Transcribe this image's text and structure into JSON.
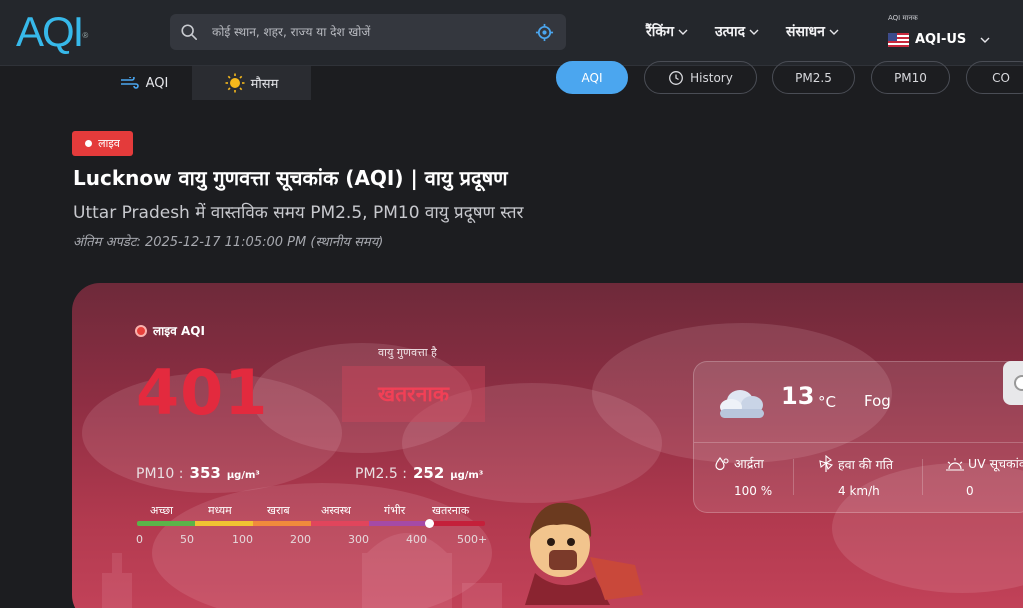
{
  "header": {
    "logo": "AQI",
    "logo_mark": "®",
    "search_placeholder": "कोई स्थान, शहर, राज्य या देश खोजें",
    "nav": [
      "रैंकिंग",
      "उत्पाद",
      "संसाधन"
    ],
    "standard_label": "AQI मानक",
    "standard_value": "AQI-US"
  },
  "subtabs": [
    "AQI",
    "मौसम"
  ],
  "pills": [
    "AQI",
    "History",
    "PM2.5",
    "PM10",
    "CO"
  ],
  "title": {
    "badge": "लाइव",
    "heading": "Lucknow वायु गुणवत्ता सूचकांक (AQI) | वायु प्रदूषण",
    "subheading": "Uttar Pradesh में वास्तविक समय PM2.5, PM10 वायु प्रदूषण स्तर",
    "updated": "अंतिम अपडेट: 2025-12-17 11:05:00 PM (स्थानीय समय)"
  },
  "aqi": {
    "live_label": "लाइव AQI",
    "value": "401",
    "quality_label": "वायु गुणवत्ता है",
    "status": "खतरनाक",
    "pm10_label": "PM10 :",
    "pm10_value": "353",
    "pm25_label": "PM2.5 :",
    "pm25_value": "252",
    "unit": "µg/m³",
    "scale_labels": [
      "अच्छा",
      "मध्यम",
      "खराब",
      "अस्वस्थ",
      "गंभीर",
      "खतरनाक"
    ],
    "scale_numbers": [
      "0",
      "50",
      "100",
      "200",
      "300",
      "400",
      "500+"
    ],
    "scale_colors": [
      "#5bb349",
      "#f1c232",
      "#f08a3c",
      "#e1455c",
      "#a54aa7",
      "#c4203a"
    ]
  },
  "weather": {
    "temp": "13",
    "unit": "°C",
    "condition": "Fog",
    "humidity_label": "आर्द्रता",
    "humidity_value": "100 %",
    "wind_label": "हवा की गति",
    "wind_value": "4 km/h",
    "uv_label": "UV सूचकांक",
    "uv_value": "0"
  }
}
